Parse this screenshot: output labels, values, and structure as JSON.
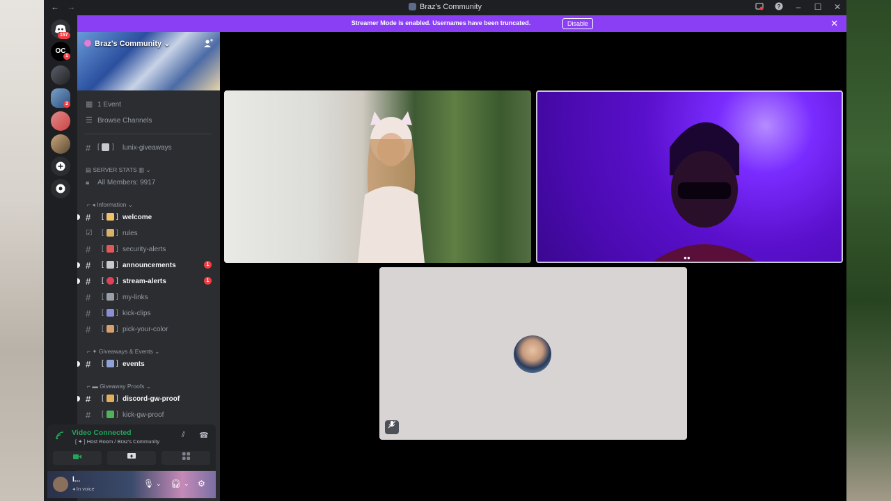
{
  "window": {
    "title": "Braz's Community",
    "nav_back": "←",
    "nav_forward": "→",
    "icons": [
      "inbox-icon",
      "help-icon",
      "minimize-icon",
      "maximize-icon",
      "close-icon"
    ]
  },
  "banner": {
    "text": "Streamer Mode is enabled. Usernames have been truncated.",
    "button": "Disable"
  },
  "rail": {
    "dm_badge": "157",
    "server_badge_1": "1",
    "server_badge_2": "2"
  },
  "server": {
    "name": "Braz's Community",
    "events": "1 Event",
    "browse": "Browse Channels"
  },
  "channels": {
    "giveaways": "lunix-giveaways",
    "server_stats": "SERVER STATS",
    "members": "All Members: 9917",
    "cat_info": "Information",
    "welcome": "welcome",
    "rules": "rules",
    "security": "security-alerts",
    "announcements": "announcements",
    "announcements_count": "1",
    "stream_alerts": "stream-alerts",
    "stream_alerts_count": "1",
    "my_links": "my-links",
    "kick_clips": "kick-clips",
    "pick_color": "pick-your-color",
    "cat_giveaways": "Giveaways & Events",
    "events": "events",
    "cat_proofs": "Giveaway Proofs",
    "discord_proof": "discord-gw-proof",
    "kick_proof": "kick-gw-proof"
  },
  "voice": {
    "title": "Video Connected",
    "subtitle": "Host Room / Braz's Community"
  },
  "user": {
    "name": "l...",
    "status": "In voice"
  },
  "colors": {
    "banner": "#8b3ff5",
    "online_green": "#23a55a",
    "mention_red": "#f23f43"
  }
}
